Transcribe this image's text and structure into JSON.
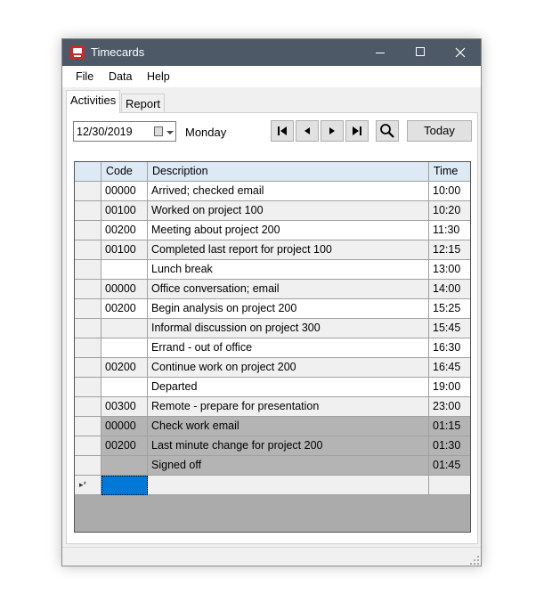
{
  "window": {
    "title": "Timecards"
  },
  "menu": [
    "File",
    "Data",
    "Help"
  ],
  "tabs": [
    "Activities",
    "Report"
  ],
  "toolbar": {
    "date": "12/30/2019",
    "day": "Monday",
    "today_label": "Today"
  },
  "table": {
    "columns": [
      "Code",
      "Description",
      "Time"
    ],
    "rows": [
      {
        "code": "00000",
        "description": "Arrived; checked email",
        "time": "10:00",
        "bg": "#ffffff"
      },
      {
        "code": "00100",
        "description": "Worked on project 100",
        "time": "10:20",
        "bg": "#f0f0f0"
      },
      {
        "code": "00200",
        "description": "Meeting about project 200",
        "time": "11:30",
        "bg": "#ffffff"
      },
      {
        "code": "00100",
        "description": "Completed last report for project 100",
        "time": "12:15",
        "bg": "#f0f0f0"
      },
      {
        "code": "",
        "description": "Lunch break",
        "time": "13:00",
        "bg": "#ffffff"
      },
      {
        "code": "00000",
        "description": "Office conversation; email",
        "time": "14:00",
        "bg": "#f0f0f0"
      },
      {
        "code": "00200",
        "description": "Begin analysis on project 200",
        "time": "15:25",
        "bg": "#ffffff"
      },
      {
        "code": "",
        "description": "Informal discussion on project 300",
        "time": "15:45",
        "bg": "#f0f0f0"
      },
      {
        "code": "",
        "description": "Errand - out of office",
        "time": "16:30",
        "bg": "#ffffff"
      },
      {
        "code": "00200",
        "description": "Continue work on project 200",
        "time": "16:45",
        "bg": "#f0f0f0"
      },
      {
        "code": "",
        "description": "Departed",
        "time": "19:00",
        "bg": "#ffffff"
      },
      {
        "code": "00300",
        "description": "Remote - prepare for presentation",
        "time": "23:00",
        "bg": "#f0f0f0"
      },
      {
        "code": "00000",
        "description": "Check work email",
        "time": "01:15",
        "bg": "#b4b4b4"
      },
      {
        "code": "00200",
        "description": "Last minute change for project 200",
        "time": "01:30",
        "bg": "#b4b4b4"
      },
      {
        "code": "",
        "description": "Signed off",
        "time": "01:45",
        "bg": "#b4b4b4"
      }
    ],
    "new_row_marker": "▸*",
    "selection_color": "#0078d7"
  }
}
